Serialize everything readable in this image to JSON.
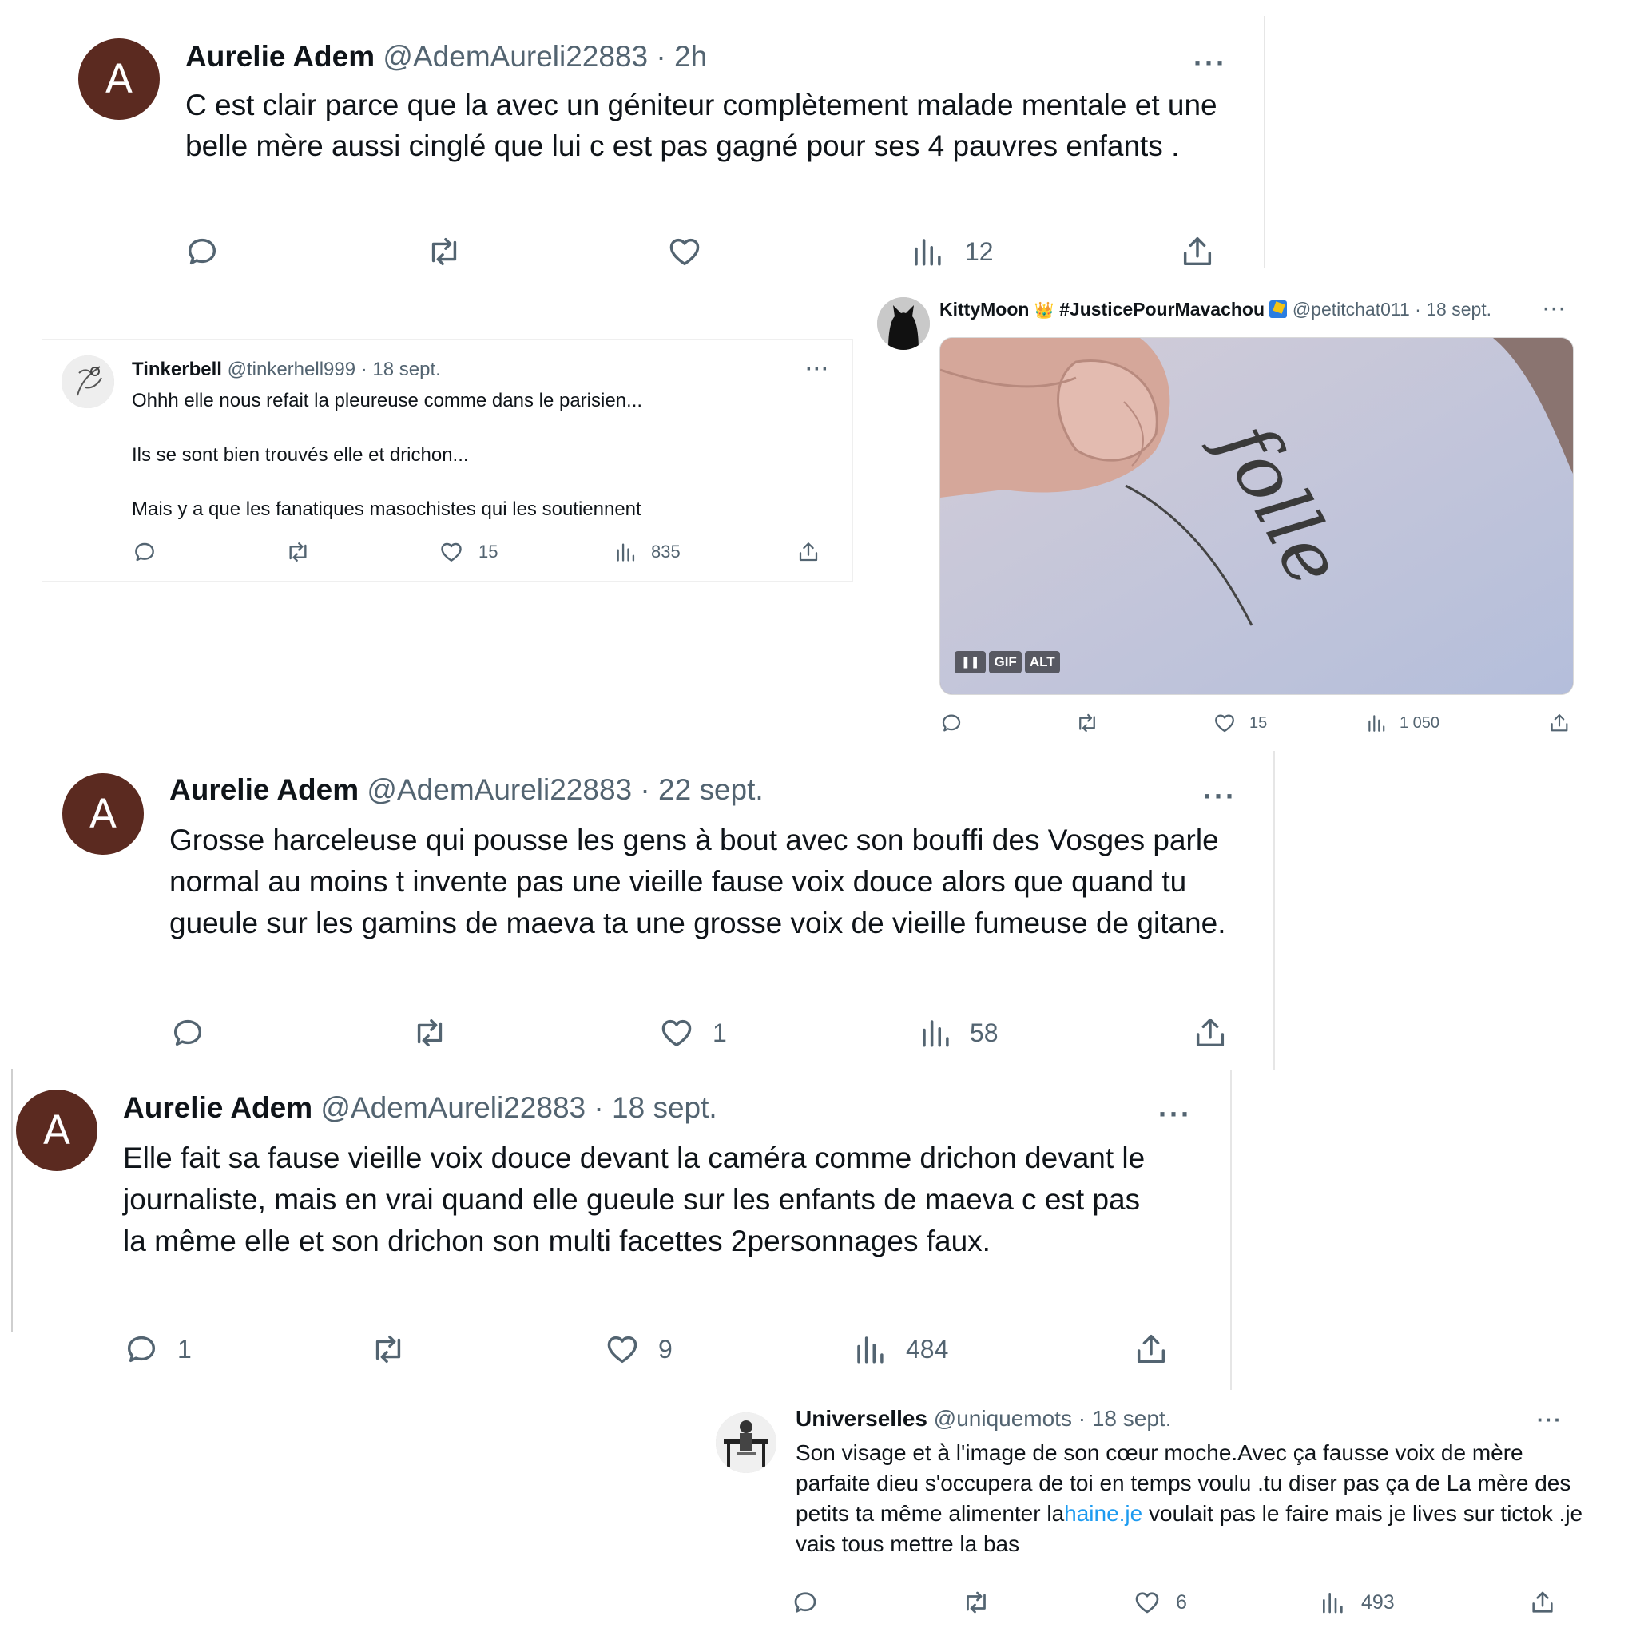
{
  "tweet1": {
    "avatar_letter": "A",
    "name": "Aurelie Adem",
    "handle": "@AdemAureli22883",
    "sep": "·",
    "time": "2h",
    "more": "···",
    "text": "C est clair parce que la avec un géniteur complètement malade mentale et une belle mère aussi cinglé que lui c est pas gagné pour ses 4 pauvres enfants .",
    "views": "12"
  },
  "tweet2": {
    "name": "Tinkerbell",
    "handle": "@tinkerhell999",
    "sep": "·",
    "time": "18 sept.",
    "more": "···",
    "lines": [
      "Ohhh elle nous refait la pleureuse comme dans le parisien...",
      "Ils se sont bien trouvés elle et drichon...",
      "Mais y a que les fanatiques masochistes qui les soutiennent"
    ],
    "likes": "15",
    "views": "835"
  },
  "tweet3": {
    "name": "KittyMoon",
    "crown": "👑",
    "hashtag": "#JusticePourMavachou",
    "handle": "@petitchat011",
    "sep": "·",
    "time": "18 sept.",
    "more": "···",
    "media_text": "folle",
    "badge_pause": "❚❚",
    "badge_gif": "GIF",
    "badge_alt": "ALT",
    "likes": "15",
    "views": "1 050"
  },
  "tweet4": {
    "avatar_letter": "A",
    "name": "Aurelie Adem",
    "handle": "@AdemAureli22883",
    "sep": "·",
    "time": "22 sept.",
    "more": "···",
    "text": "Grosse harceleuse qui pousse les gens à bout avec son bouffi des Vosges parle normal au moins t invente pas une vieille fause voix douce alors que quand tu gueule sur les gamins de maeva ta une  grosse voix de vieille fumeuse de gitane.",
    "likes": "1",
    "views": "58"
  },
  "tweet5": {
    "avatar_letter": "A",
    "name": "Aurelie Adem",
    "handle": "@AdemAureli22883",
    "sep": "·",
    "time": "18 sept.",
    "more": "···",
    "text": "Elle fait sa  fause vieille voix douce devant  la caméra comme drichon devant  le journaliste, mais en vrai quand elle gueule sur les enfants de maeva c est pas la même elle et son drichon son multi facettes 2personnages faux.",
    "replies": "1",
    "likes": "9",
    "views": "484"
  },
  "tweet6": {
    "name": "Universelles",
    "handle": "@uniquemots",
    "sep": "·",
    "time": "18 sept.",
    "more": "···",
    "text_before": "Son visage et à  l'image de son cœur moche.Avec ça fausse voix de mère parfaite dieu s'occupera de toi en temps voulu .tu diser pas ça de La mère des petits ta même alimenter la",
    "link": "haine.je",
    "text_after": " voulait pas le faire mais je lives sur tictok .je vais tous mettre la bas",
    "likes": "6",
    "views": "493"
  }
}
